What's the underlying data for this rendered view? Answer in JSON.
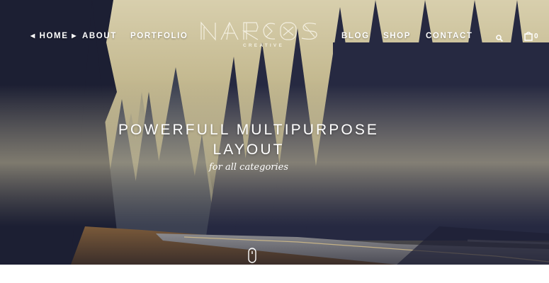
{
  "nav": {
    "left": [
      {
        "label": "HOME",
        "active": true
      },
      {
        "label": "ABOUT"
      },
      {
        "label": "PORTFOLIO"
      }
    ],
    "right": [
      {
        "label": "BLOG"
      },
      {
        "label": "SHOP"
      },
      {
        "label": "CONTACT"
      }
    ],
    "search_icon": "search-icon",
    "cart_icon": "shopping-bag-icon",
    "cart_count": "0"
  },
  "logo": {
    "name": "NARCOS",
    "subtitle": "CREATIVE"
  },
  "hero": {
    "headline_line1": "POWERFULL MULTIPURPOSE",
    "headline_line2": "LAYOUT",
    "tagline": "for all categories",
    "scroll_icon": "mouse-scroll-icon"
  },
  "colors": {
    "text": "#ffffff",
    "sky_top": "#d8cfad",
    "forest_dark": "#20223a",
    "page_background": "#ffffff"
  }
}
